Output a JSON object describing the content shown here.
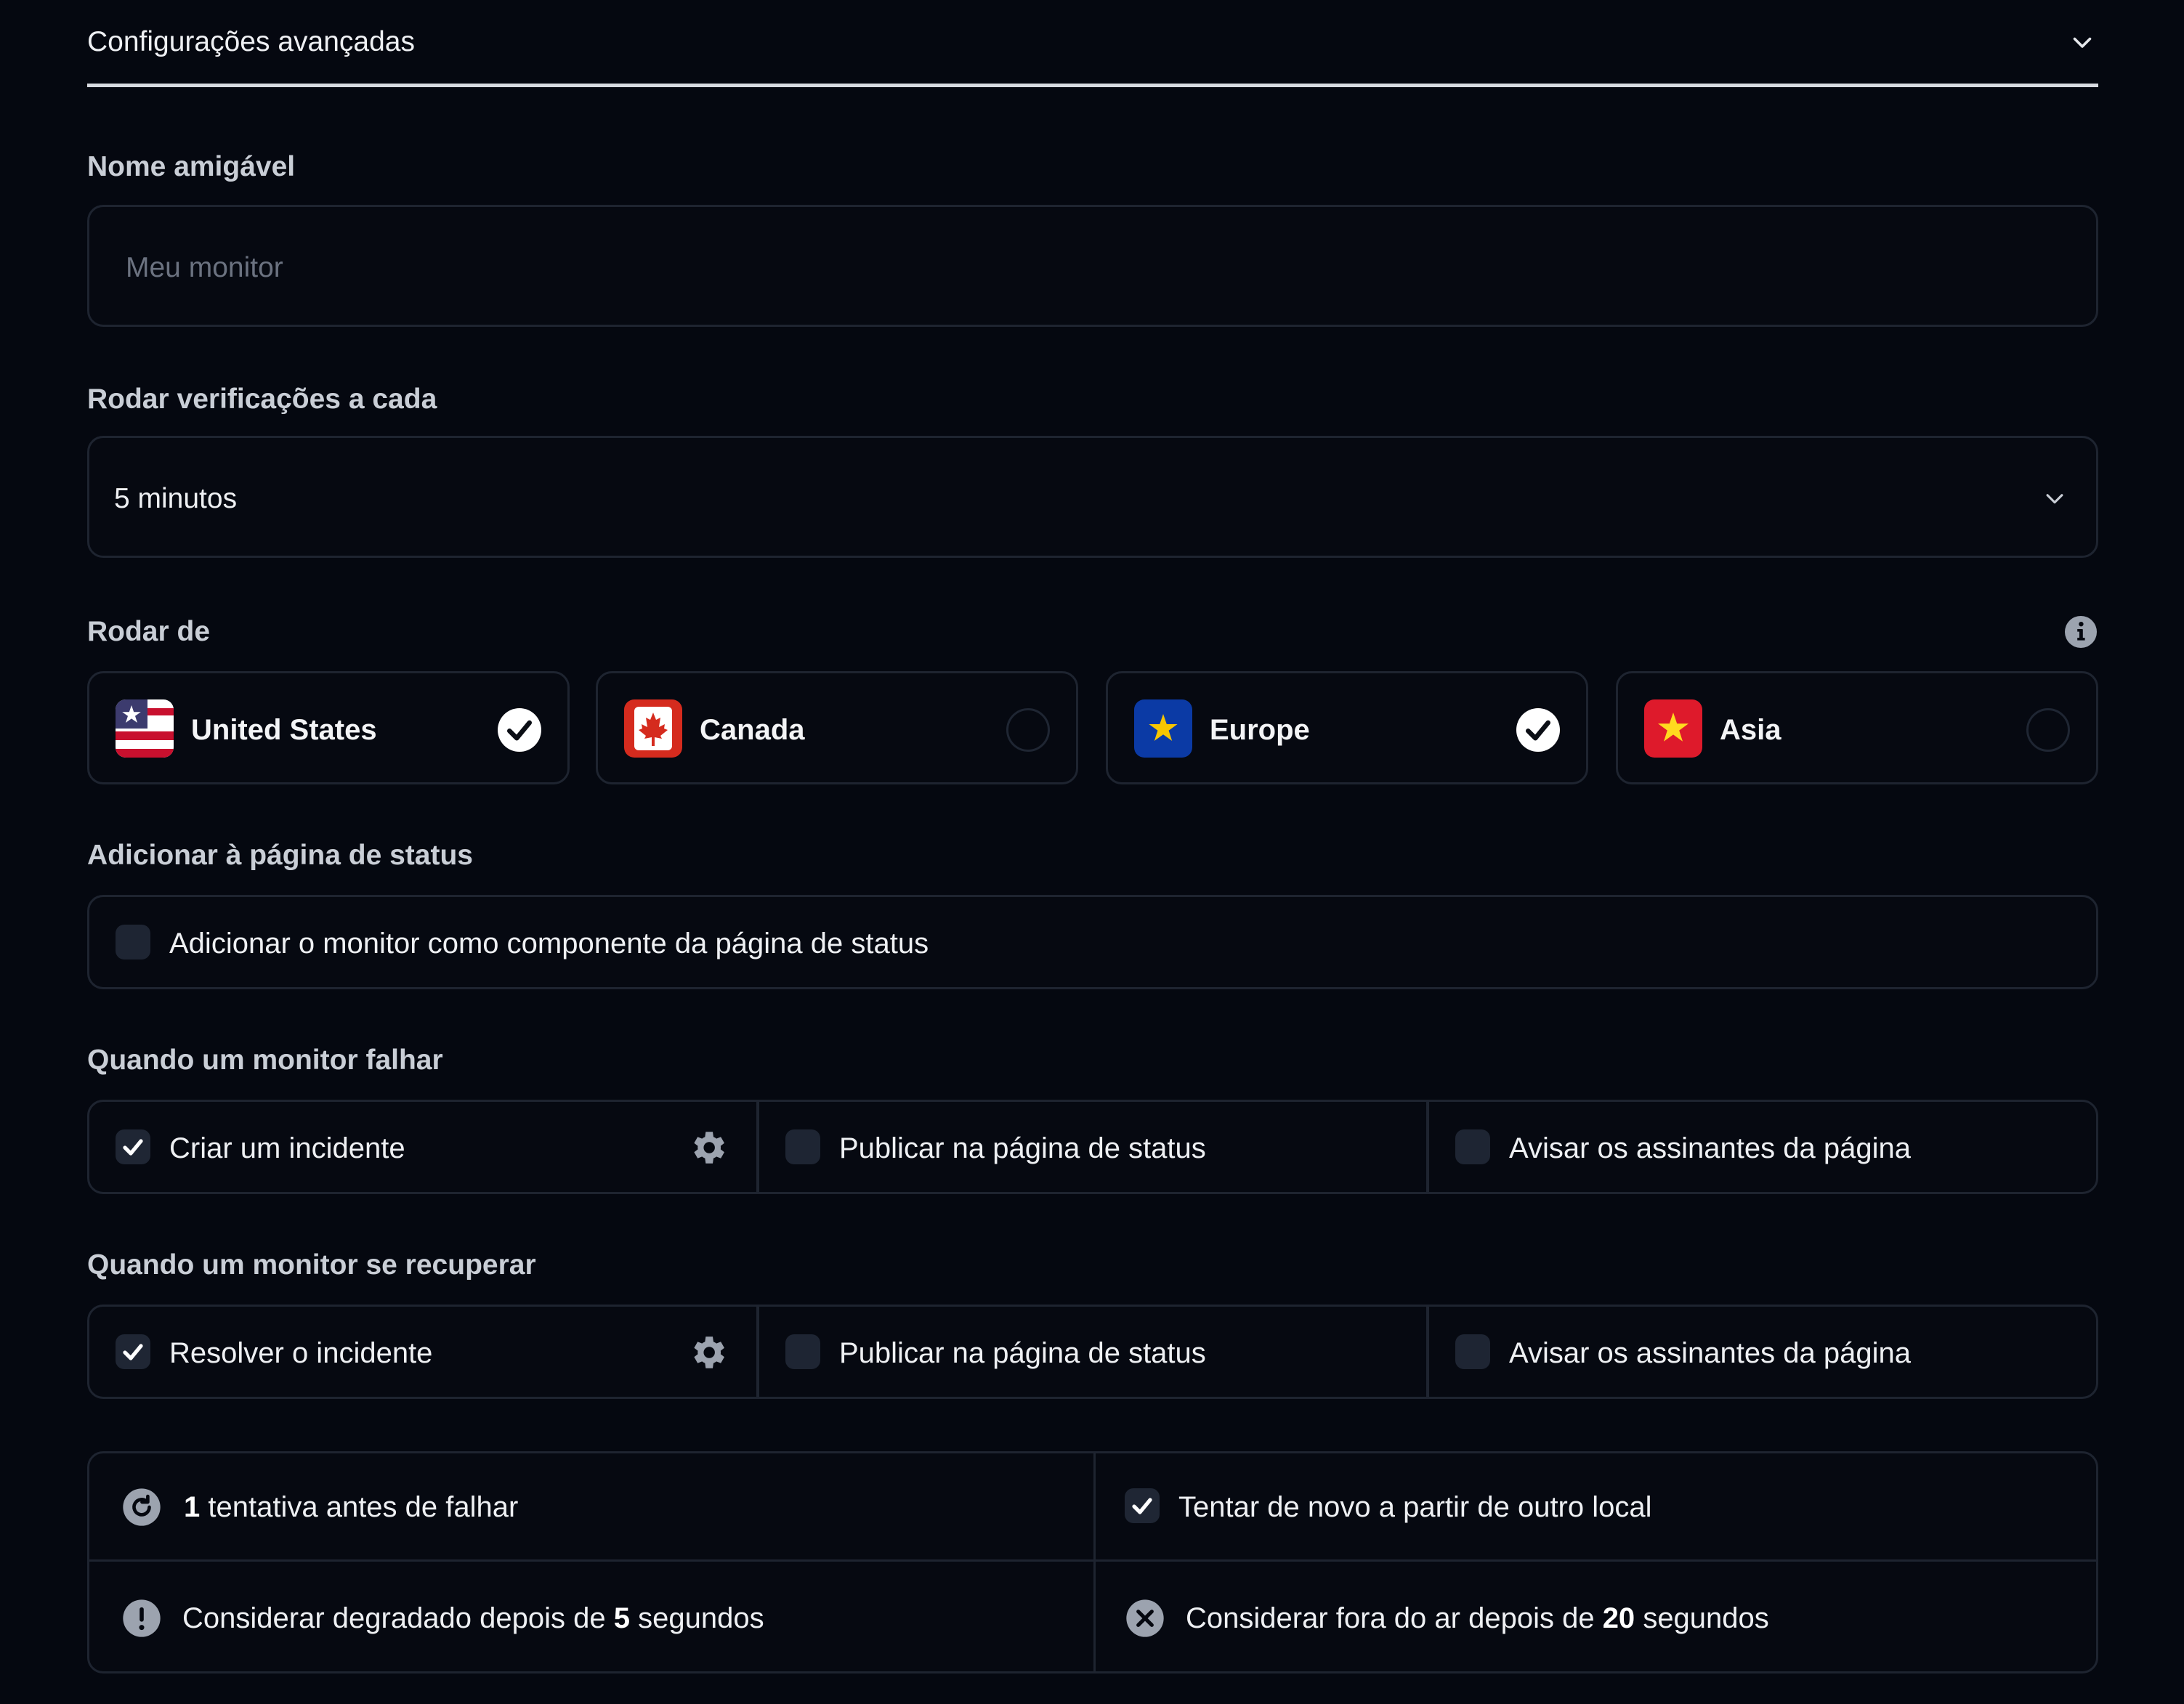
{
  "accordion": {
    "title": "Configurações avançadas"
  },
  "friendly_name": {
    "label": "Nome amigável",
    "placeholder": "Meu monitor"
  },
  "interval": {
    "label": "Rodar verificações a cada",
    "value": "5 minutos"
  },
  "regions": {
    "label": "Rodar de",
    "items": [
      {
        "name": "United States",
        "checked": true
      },
      {
        "name": "Canada",
        "checked": false
      },
      {
        "name": "Europe",
        "checked": true
      },
      {
        "name": "Asia",
        "checked": false
      }
    ]
  },
  "status_page": {
    "label": "Adicionar à página de status",
    "option": "Adicionar o monitor como componente da página de status",
    "checked": false
  },
  "on_fail": {
    "label": "Quando um monitor falhar",
    "options": [
      {
        "text": "Criar um incidente",
        "checked": true
      },
      {
        "text": "Publicar na página de status",
        "checked": false
      },
      {
        "text": "Avisar os assinantes da página",
        "checked": false
      }
    ]
  },
  "on_recover": {
    "label": "Quando um monitor se recuperar",
    "options": [
      {
        "text": "Resolver o incidente",
        "checked": true
      },
      {
        "text": "Publicar na página de status",
        "checked": false
      },
      {
        "text": "Avisar os assinantes da página",
        "checked": false
      }
    ]
  },
  "retries": {
    "count": "1",
    "text": "tentativa antes de falhar",
    "retry_other_location": "Tentar de novo a partir de outro local",
    "degraded_prefix": "Considerar degradado depois de",
    "degraded_value": "5",
    "degraded_suffix": "segundos",
    "down_prefix": "Considerar fora do ar depois de",
    "down_value": "20",
    "down_suffix": "segundos"
  }
}
